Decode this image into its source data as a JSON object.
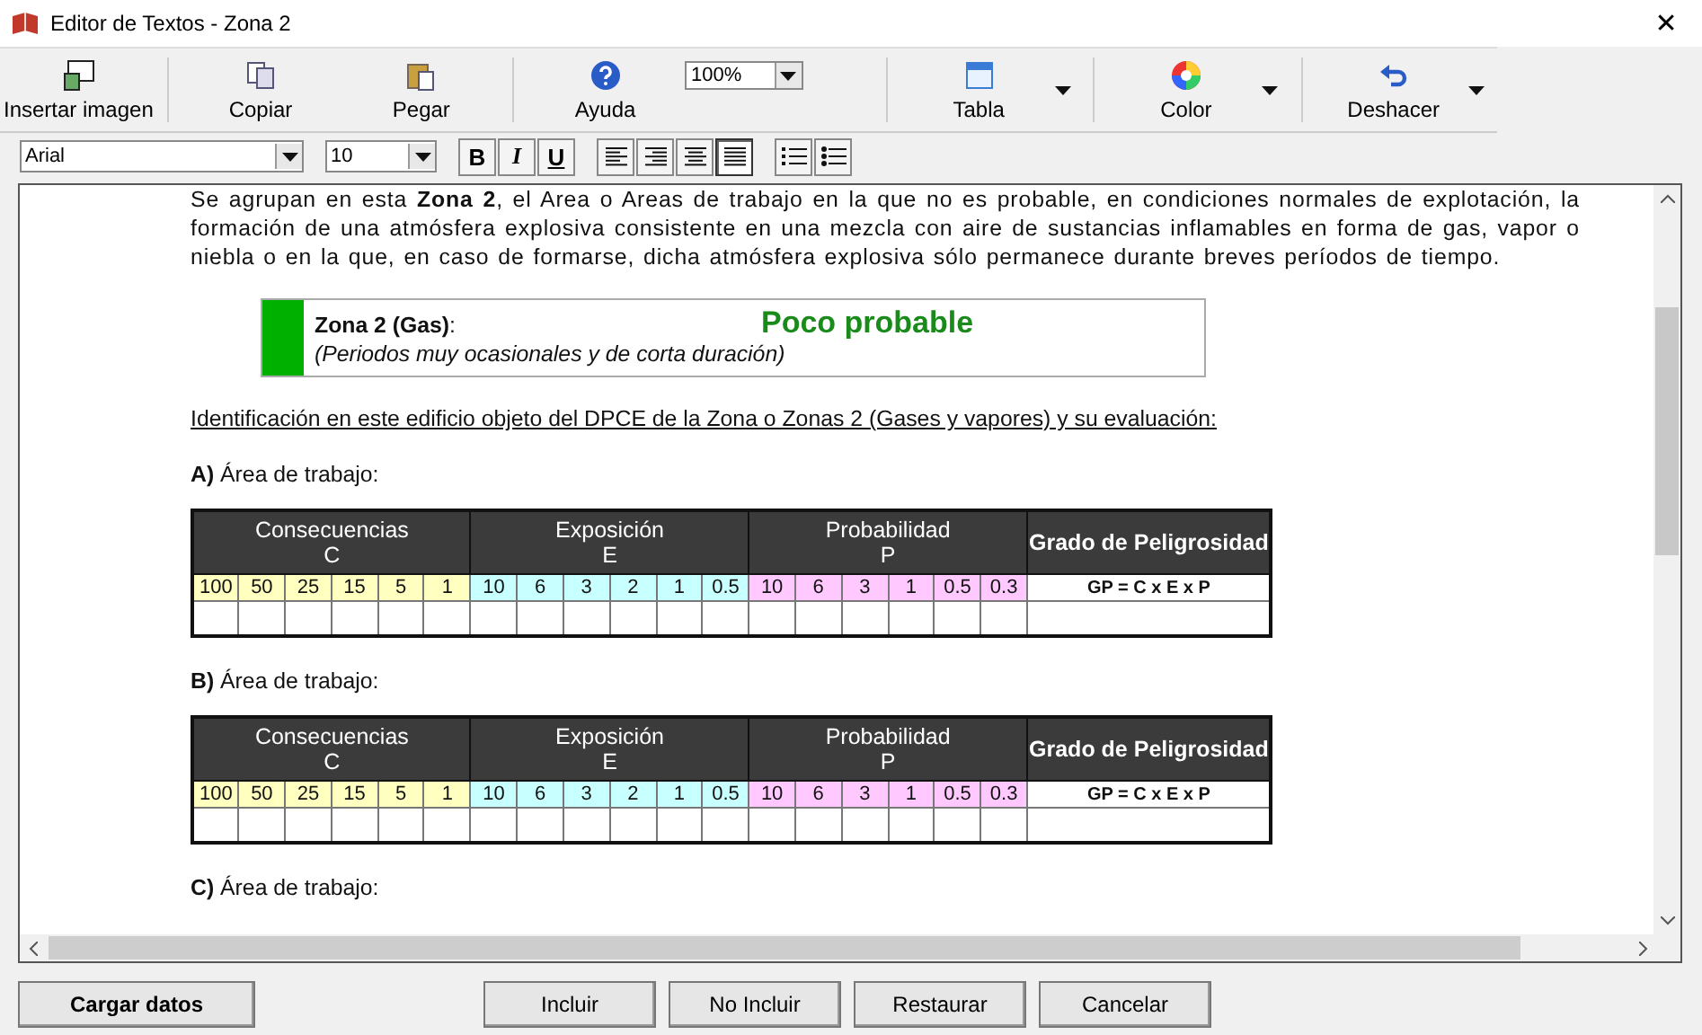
{
  "window": {
    "title": "Editor de Textos - Zona 2",
    "close": "✕"
  },
  "toolbar": [
    {
      "kind": "button",
      "label": "Insertar imagen",
      "menu": false
    },
    {
      "kind": "button",
      "label": "Copiar",
      "menu": false
    },
    {
      "kind": "button",
      "label": "Pegar",
      "menu": false
    },
    {
      "kind": "button",
      "label": "Ayuda",
      "menu": false
    },
    {
      "kind": "zoom",
      "value": "100%"
    },
    {
      "kind": "button",
      "label": "Tabla",
      "menu": true
    },
    {
      "kind": "button",
      "label": "Color",
      "menu": true
    },
    {
      "kind": "button",
      "label": "Deshacer",
      "menu": true
    }
  ],
  "format_bar": {
    "font": "Arial",
    "size": "10",
    "styles": [
      {
        "kind": "bold",
        "label": "B"
      },
      {
        "kind": "italic",
        "label": "I"
      },
      {
        "kind": "underline",
        "label": "U"
      }
    ],
    "align": [
      {
        "kind": "left",
        "selected": false
      },
      {
        "kind": "right",
        "selected": false
      },
      {
        "kind": "center",
        "selected": false
      },
      {
        "kind": "justify",
        "selected": true
      }
    ],
    "lists": [
      {
        "kind": "numbered"
      },
      {
        "kind": "bulleted"
      }
    ]
  },
  "document": {
    "intro": "Se agrupan en esta **Zona 2**, el Area o Areas de trabajo en la que no es probable, en condiciones normales de explotación, la formación de una atmósfera explosiva consistente en una mezcla con aire de sustancias inflamables en forma de gas, vapor o niebla o en la que, en caso de formarse, dicha atmósfera explosiva sólo permanece durante breves períodos de tiempo.",
    "zone_box": {
      "color": "#00b000",
      "title": "Zona 2 (Gas)",
      "colon": ":",
      "rating": "Poco probable",
      "note": "(Periodos muy ocasionales y de corta duración)"
    },
    "heading": "Identificación en este edificio objeto del DPCE de la Zona o Zonas 2 (Gases y vapores) y su evaluación:",
    "areas": [
      {
        "letter": "A)",
        "label": "Área de trabajo:",
        "table": {
          "groups": [
            {
              "name": "Consecuencias",
              "symbol": "C",
              "color": "#ffffc0",
              "values": [
                "100",
                "50",
                "25",
                "15",
                "5",
                "1"
              ]
            },
            {
              "name": "Exposición",
              "symbol": "E",
              "color": "#c8ffff",
              "values": [
                "10",
                "6",
                "3",
                "2",
                "1",
                "0.5"
              ]
            },
            {
              "name": "Probabilidad",
              "symbol": "P",
              "color": "#ffc8ff",
              "values": [
                "10",
                "6",
                "3",
                "1",
                "0.5",
                "0.3"
              ]
            }
          ],
          "result": {
            "name": "Grado de Peligrosidad",
            "formula": "GP = C x E x P"
          }
        }
      },
      {
        "letter": "B)",
        "label": "Área de trabajo:",
        "table": {
          "groups": [
            {
              "name": "Consecuencias",
              "symbol": "C",
              "color": "#ffffc0",
              "values": [
                "100",
                "50",
                "25",
                "15",
                "5",
                "1"
              ]
            },
            {
              "name": "Exposición",
              "symbol": "E",
              "color": "#c8ffff",
              "values": [
                "10",
                "6",
                "3",
                "2",
                "1",
                "0.5"
              ]
            },
            {
              "name": "Probabilidad",
              "symbol": "P",
              "color": "#ffc8ff",
              "values": [
                "10",
                "6",
                "3",
                "1",
                "0.5",
                "0.3"
              ]
            }
          ],
          "result": {
            "name": "Grado de Peligrosidad",
            "formula": "GP = C x E x P"
          }
        }
      },
      {
        "letter": "C)",
        "label": "Área de trabajo:"
      }
    ]
  },
  "buttons": [
    {
      "label": "Cargar datos",
      "kind": "left"
    },
    {
      "label": "Incluir",
      "kind": "main"
    },
    {
      "label": "No Incluir",
      "kind": "main"
    },
    {
      "label": "Restaurar",
      "kind": "main"
    },
    {
      "label": "Cancelar",
      "kind": "main"
    }
  ]
}
